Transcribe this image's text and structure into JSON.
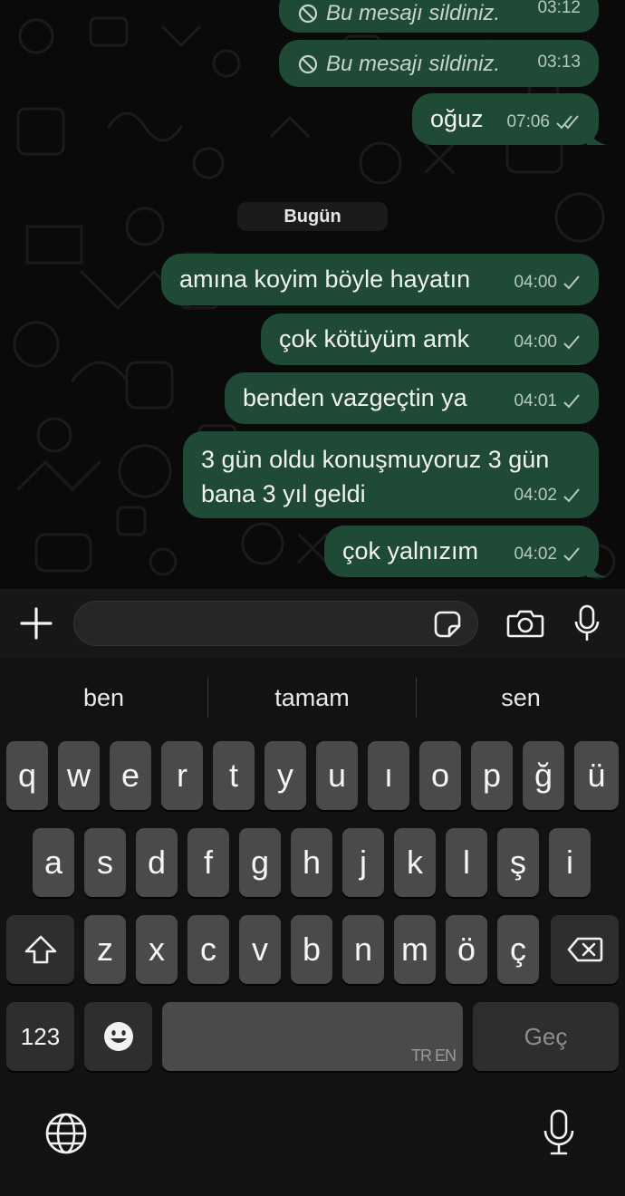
{
  "chat": {
    "messages": [
      {
        "deleted": true,
        "text": "Bu mesajı sildiniz.",
        "time": "03:12"
      },
      {
        "deleted": true,
        "text": "Bu mesajı sildiniz.",
        "time": "03:13"
      },
      {
        "deleted": false,
        "text": "oğuz",
        "time": "07:06",
        "status": "read"
      },
      {
        "deleted": false,
        "text": "amına koyim böyle hayatın",
        "time": "04:00",
        "status": "sent"
      },
      {
        "deleted": false,
        "text": "çok kötüyüm amk",
        "time": "04:00",
        "status": "sent"
      },
      {
        "deleted": false,
        "text": "benden vazgeçtin ya",
        "time": "04:01",
        "status": "sent"
      },
      {
        "deleted": false,
        "text_line1": "3 gün oldu konuşmuyoruz 3 gün",
        "text_line2": "bana 3 yıl geldi",
        "time": "04:02",
        "status": "sent"
      },
      {
        "deleted": false,
        "text": "çok yalnızım",
        "time": "04:02",
        "status": "sent"
      }
    ],
    "date_separator": "Bugün",
    "bubble_color": "#1e4a36"
  },
  "input_bar": {
    "icons": [
      "plus-icon",
      "sticker-icon",
      "camera-icon",
      "microphone-icon"
    ]
  },
  "keyboard": {
    "suggestions": [
      "ben",
      "tamam",
      "sen"
    ],
    "row1": [
      "q",
      "w",
      "e",
      "r",
      "t",
      "y",
      "u",
      "ı",
      "o",
      "p",
      "ğ",
      "ü"
    ],
    "row2": [
      "a",
      "s",
      "d",
      "f",
      "g",
      "h",
      "j",
      "k",
      "l",
      "ş",
      "i"
    ],
    "row3": [
      "z",
      "x",
      "c",
      "v",
      "b",
      "n",
      "m",
      "ö",
      "ç"
    ],
    "numbers_key": "123",
    "space_label": "TR EN",
    "return_key": "Geç",
    "icons": [
      "shift-icon",
      "backspace-icon",
      "emoji-icon",
      "globe-icon",
      "dictation-icon"
    ]
  }
}
